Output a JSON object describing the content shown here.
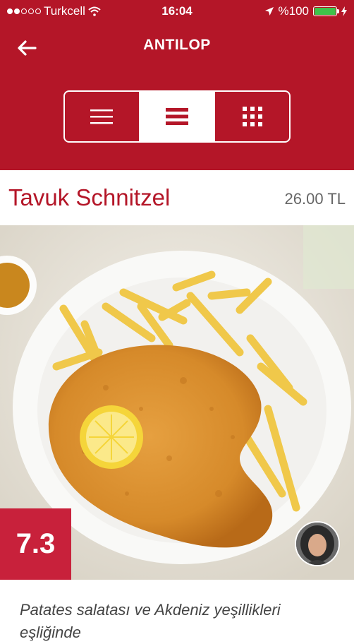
{
  "status_bar": {
    "carrier": "Turkcell",
    "time": "16:04",
    "battery_label": "%100",
    "icons": [
      "signal-dots-icon",
      "wifi-icon",
      "location-arrow-icon",
      "battery-icon",
      "charging-bolt-icon"
    ]
  },
  "nav": {
    "title": "ANTILOP",
    "back_icon": "back-arrow-icon"
  },
  "view_switcher": {
    "options": [
      {
        "icon": "list-thin-icon",
        "active": false
      },
      {
        "icon": "list-thick-icon",
        "active": true
      },
      {
        "icon": "grid-icon",
        "active": false
      }
    ]
  },
  "dish": {
    "name": "Tavuk Schnitzel",
    "price": "26.00 TL",
    "rating": "7.3",
    "description": "Patates salatası ve Akdeniz yeşillikleri eşliğinde"
  },
  "colors": {
    "brand_red": "#b41628",
    "rating_red": "#c8213b",
    "battery_green": "#3ec24a"
  }
}
